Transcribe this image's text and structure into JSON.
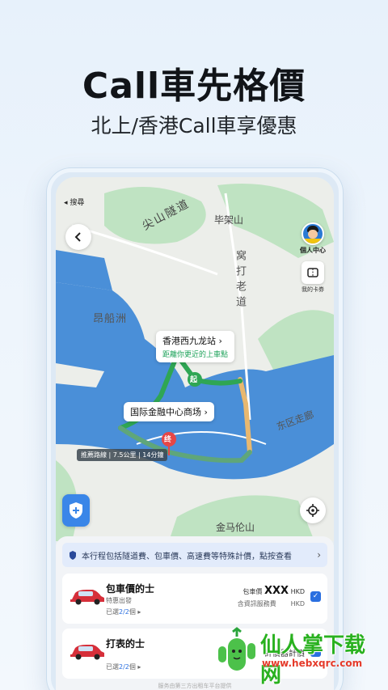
{
  "headline": "Call車先格價",
  "subheadline": "北上/香港Call車享優惠",
  "status": {
    "back_search": "◂ 搜尋"
  },
  "map": {
    "labels": {
      "tunnel": "尖山隧道",
      "peak": "毕架山",
      "road": "窝打老道",
      "island": "昂船洲",
      "east_corridor": "东区走廊",
      "jinmalun": "金马伦山"
    },
    "pickup_bubble": {
      "title": "香港西九龙站",
      "subtitle": "距離你更近的上車點"
    },
    "dropoff_bubble": {
      "title": "国际金融中心商场"
    },
    "start_marker": "起",
    "end_marker": "终",
    "route_info": "推薦路線 | 7.5公里 | 14分鐘"
  },
  "avatar": {
    "label": "個人中心"
  },
  "card": {
    "label": "我的卡券"
  },
  "sheet": {
    "notice": "本行程包括隧道費、包車價、高速費等特殊計價，點按查看",
    "rides": [
      {
        "name": "包車價的士",
        "desc": "特惠出發",
        "selected_prefix": "已選",
        "selected_count": "2/2",
        "selected_suffix": "個",
        "price_label": "包車價",
        "price": "XXX",
        "currency": "HKD",
        "note": "含資訊服務費",
        "note_currency": "HKD"
      },
      {
        "name": "打表的士",
        "desc": "",
        "selected_prefix": "已選",
        "selected_count": "2/2",
        "selected_suffix": "個",
        "price_label": "計價器計價",
        "price": "",
        "currency": "",
        "note": "",
        "note_currency": ""
      }
    ],
    "footnote": "服务由第三方出租车平台提供"
  },
  "watermark": {
    "title": "仙人掌下载网",
    "url": "www.hebxqrc.com"
  },
  "colors": {
    "route": "#2fa654",
    "water": "#4a8fd8",
    "accent": "#2a6fe0",
    "land": "#eceeea",
    "green": "#bfe3c2"
  }
}
